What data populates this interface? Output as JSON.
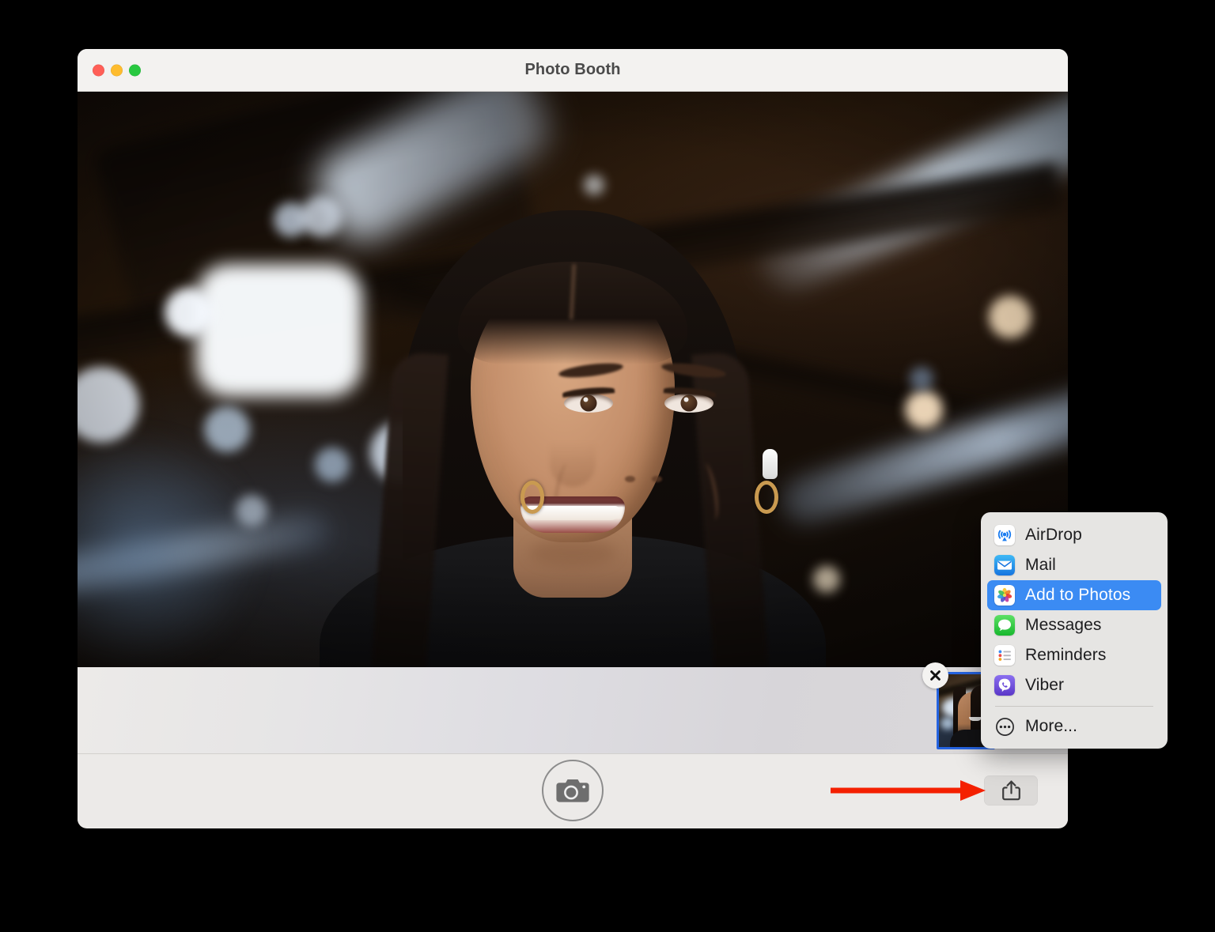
{
  "window": {
    "title": "Photo Booth",
    "traffic_lights": [
      {
        "name": "close",
        "color": "#ff5f57"
      },
      {
        "name": "minimize",
        "color": "#febc2e"
      },
      {
        "name": "maximize",
        "color": "#28c840"
      }
    ]
  },
  "viewfinder": {
    "description": "Live camera preview: smiling woman with long dark hair, gold hoop earrings and AirPods, in front of a blurred industrial ceiling with wooden beams and bright window light",
    "scene_colors": {
      "background_dark": "#140d08",
      "background_warm": "#241609",
      "highlight_light": "#e1f0ff",
      "skin": "#c5906c",
      "hair": "#120d0a",
      "top": "#1a1a1c"
    }
  },
  "filmstrip": {
    "thumbnail": {
      "name": "captured-photo-thumbnail",
      "selected": true,
      "selection_color": "#2563e0"
    },
    "close_badge": {
      "name": "delete-photo-badge",
      "glyph": "close-icon"
    }
  },
  "toolbar": {
    "shutter": {
      "name": "camera-shutter-button",
      "icon": "camera-icon"
    },
    "share": {
      "name": "share-button",
      "icon": "share-icon"
    }
  },
  "annotation": {
    "arrow": {
      "name": "red-pointer-arrow",
      "color": "#f42000",
      "direction": "right"
    }
  },
  "share_menu": {
    "items": [
      {
        "label": "AirDrop",
        "icon": "airdrop-icon",
        "selected": false
      },
      {
        "label": "Mail",
        "icon": "mail-icon",
        "selected": false
      },
      {
        "label": "Add to Photos",
        "icon": "photos-icon",
        "selected": true
      },
      {
        "label": "Messages",
        "icon": "messages-icon",
        "selected": false
      },
      {
        "label": "Reminders",
        "icon": "reminders-icon",
        "selected": false
      },
      {
        "label": "Viber",
        "icon": "viber-icon",
        "selected": false
      }
    ],
    "more": {
      "label": "More...",
      "icon": "more-ellipsis-icon"
    },
    "highlight_color": "#3b8bf3",
    "background_color": "#e6e5e3"
  }
}
